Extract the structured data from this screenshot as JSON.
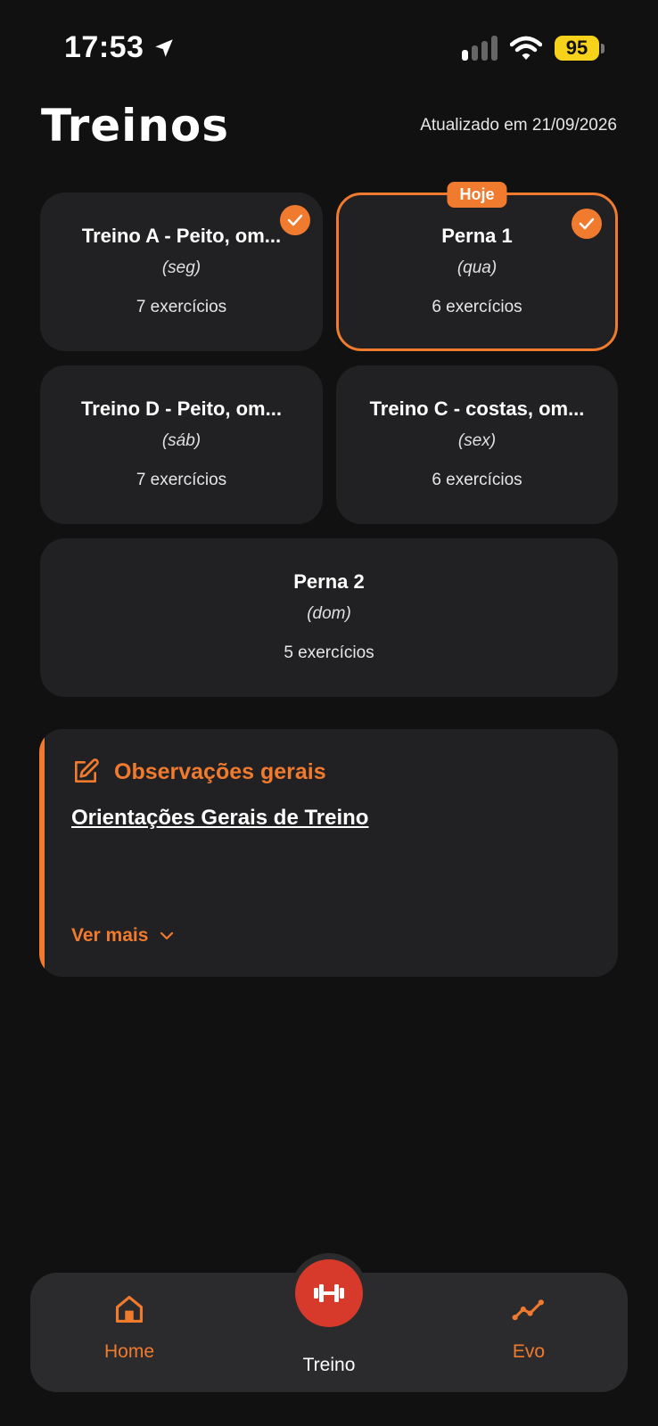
{
  "status_bar": {
    "time": "17:53",
    "battery": "95"
  },
  "header": {
    "title": "Treinos",
    "updated": "Atualizado em 21/09/2026"
  },
  "workouts": [
    {
      "title": "Treino A - Peito, om...",
      "day": "(seg)",
      "count": "7 exercícios",
      "done": true,
      "today": false
    },
    {
      "title": "Perna 1",
      "day": "(qua)",
      "count": "6 exercícios",
      "done": true,
      "today": true,
      "badge": "Hoje"
    },
    {
      "title": "Treino D - Peito, om...",
      "day": "(sáb)",
      "count": "7 exercícios",
      "done": false,
      "today": false
    },
    {
      "title": "Treino C - costas, om...",
      "day": "(sex)",
      "count": "6 exercícios",
      "done": false,
      "today": false
    },
    {
      "title": "Perna 2",
      "day": "(dom)",
      "count": "5 exercícios",
      "done": false,
      "today": false
    }
  ],
  "observations": {
    "title": "Observações gerais",
    "link": "Orientações Gerais de Treino",
    "more": "Ver mais"
  },
  "nav": {
    "home": "Home",
    "treino": "Treino",
    "evo": "Evo"
  },
  "colors": {
    "accent": "#f07a2e",
    "center_button": "#d73a2b",
    "card": "#212123",
    "background": "#111111"
  }
}
